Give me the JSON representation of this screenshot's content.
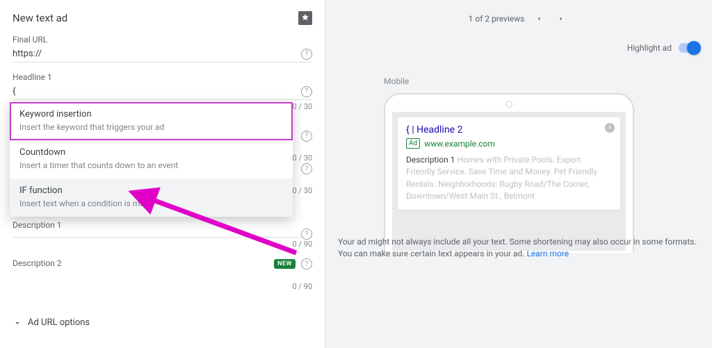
{
  "editor": {
    "title": "New text ad",
    "final_url_label": "Final URL",
    "final_url_value": "https://",
    "headline1_label": "Headline 1",
    "headline1_value": "{",
    "counters": {
      "h1": "0 / 30",
      "h2": "0 / 30",
      "h3": "0 / 30",
      "d1": "0 / 90",
      "d2": "0 / 90"
    },
    "new_badge": "NEW",
    "description1_label": "Description 1",
    "description2_label": "Description 2",
    "url_options": "Ad URL options",
    "suggestions": [
      {
        "title": "Keyword insertion",
        "desc": "Insert the keyword that triggers your ad"
      },
      {
        "title": "Countdown",
        "desc": "Insert a timer that counts down to an event"
      },
      {
        "title": "IF function",
        "desc": "Insert text when a condition is met"
      }
    ]
  },
  "preview": {
    "nav_text": "1 of 2 previews",
    "highlight_label": "Highlight ad",
    "device_label": "Mobile",
    "ad": {
      "headline": "{ | Headline 2",
      "ad_badge": "Ad",
      "display_url": "www.example.com",
      "desc_lead": "Description 1",
      "desc_placeholder": " Homes with Private Pools. Expert Friendly Service. Save Time and Money. Pet Friendly Rentals. Neighborhoods: Rugby Road/The Corner, Downtown/West Main St., Belmont"
    },
    "disclaimer_text": "Your ad might not always include all your text. Some shortening may also occur in some formats. You can make sure certain text appears in your ad. ",
    "learn_more": "Learn more"
  }
}
